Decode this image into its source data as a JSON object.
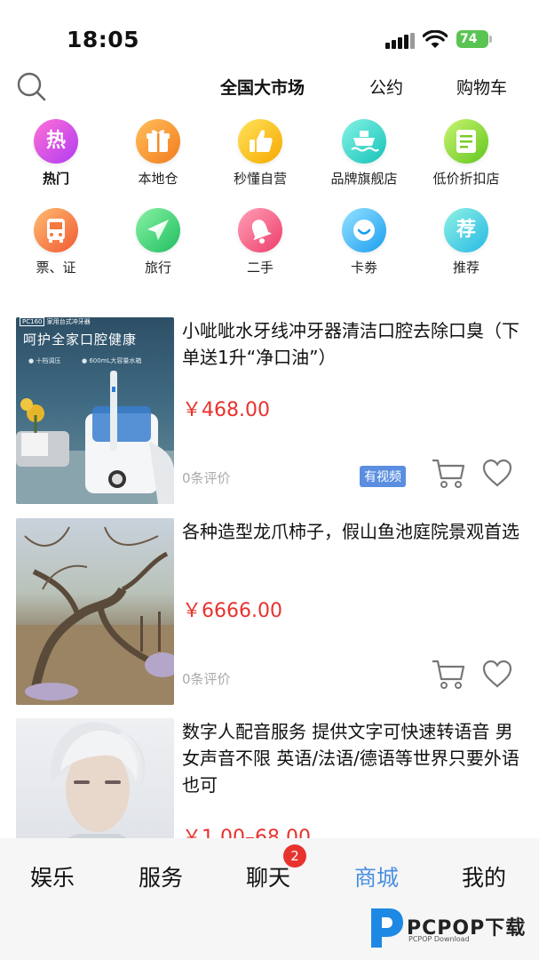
{
  "status": {
    "time": "18:05",
    "battery": "74"
  },
  "top_tabs": [
    "全国大市场",
    "公约",
    "购物车"
  ],
  "categories": [
    {
      "label": "热门",
      "icon_text": "热",
      "icon": "fire-icon",
      "color_from": "#ff5fd0",
      "color_to": "#b13cf2"
    },
    {
      "label": "本地仓",
      "icon_text": "",
      "icon": "gift-icon",
      "color_from": "#ffb347",
      "color_to": "#f27c1e"
    },
    {
      "label": "秒懂自营",
      "icon_text": "",
      "icon": "thumbs-up-icon",
      "color_from": "#ffe056",
      "color_to": "#f6a800"
    },
    {
      "label": "品牌旗舰店",
      "icon_text": "",
      "icon": "ship-icon",
      "color_from": "#7ff2e4",
      "color_to": "#15c2b8"
    },
    {
      "label": "低价折扣店",
      "icon_text": "",
      "icon": "receipt-icon",
      "color_from": "#c4f26a",
      "color_to": "#63c61f"
    },
    {
      "label": "票、证",
      "icon_text": "",
      "icon": "bus-icon",
      "color_from": "#ffb66a",
      "color_to": "#f05a32"
    },
    {
      "label": "旅行",
      "icon_text": "",
      "icon": "airplane-icon",
      "color_from": "#84f09e",
      "color_to": "#1fbe61"
    },
    {
      "label": "二手",
      "icon_text": "",
      "icon": "bell-icon",
      "color_from": "#ff9ab2",
      "color_to": "#ee3d6a"
    },
    {
      "label": "卡劵",
      "icon_text": "",
      "icon": "smile-icon",
      "color_from": "#8fe0ff",
      "color_to": "#1a9ef0"
    },
    {
      "label": "推荐",
      "icon_text": "荐",
      "icon": "recommend-icon",
      "color_from": "#8af0e0",
      "color_to": "#27b8e6"
    }
  ],
  "products": [
    {
      "title": "小呲呲水牙线冲牙器清洁口腔去除口臭（下单送1升“净口油”）",
      "price": "￥468.00",
      "reviews": "0条评价",
      "badge": "有视频",
      "thumb_tag": "PC160",
      "thumb_tag2": "家用台式冲牙器",
      "thumb_headline": "呵护全家口腔健康",
      "thumb_feat1": "● 十档调压",
      "thumb_feat2": "● 600mL大容量水箱"
    },
    {
      "title": "各种造型龙爪柿子，假山鱼池庭院景观首选",
      "price": "￥6666.00",
      "reviews": "0条评价",
      "badge": ""
    },
    {
      "title": "数字人配音服务 提供文字可快速转语音 男女声音不限 英语/法语/德语等世界只要外语也可",
      "price": "￥1.00–68.00",
      "reviews": "",
      "badge": ""
    }
  ],
  "tabbar": {
    "items": [
      "娱乐",
      "服务",
      "聊天",
      "商城",
      "我的"
    ],
    "chat_badge": "2",
    "active": "商城"
  },
  "watermark": {
    "text": "PCPOP下载",
    "sub": "PCPOP Download"
  }
}
